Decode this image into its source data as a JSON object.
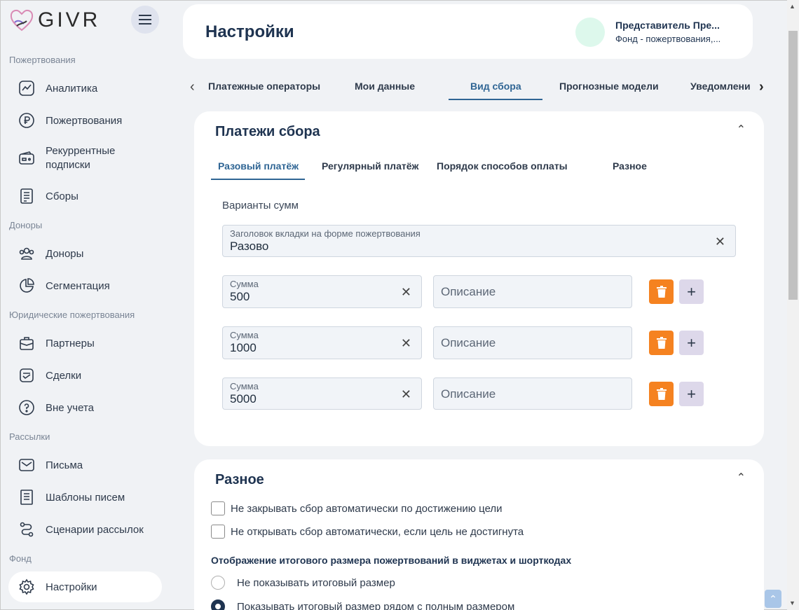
{
  "app": {
    "logo_text": "GIVR"
  },
  "sidebar": {
    "sections": [
      {
        "title": "Пожертвования",
        "items": [
          {
            "label": "Аналитика",
            "icon": "analytics-icon"
          },
          {
            "label": "Пожертвования",
            "icon": "ruble-icon"
          },
          {
            "label": "Рекуррентные подписки",
            "icon": "wallet-icon"
          },
          {
            "label": "Сборы",
            "icon": "receipt-icon"
          }
        ]
      },
      {
        "title": "Доноры",
        "items": [
          {
            "label": "Доноры",
            "icon": "users-icon"
          },
          {
            "label": "Сегментация",
            "icon": "pie-chart-icon"
          }
        ]
      },
      {
        "title": "Юридические пожертвования",
        "items": [
          {
            "label": "Партнеры",
            "icon": "briefcase-icon"
          },
          {
            "label": "Сделки",
            "icon": "deal-icon"
          },
          {
            "label": "Вне учета",
            "icon": "question-icon"
          }
        ]
      },
      {
        "title": "Рассылки",
        "items": [
          {
            "label": "Письма",
            "icon": "mail-icon"
          },
          {
            "label": "Шаблоны писем",
            "icon": "template-icon"
          },
          {
            "label": "Сценарии рассылок",
            "icon": "route-icon"
          }
        ]
      },
      {
        "title": "Фонд",
        "items": [
          {
            "label": "Настройки",
            "icon": "gear-icon",
            "active": true
          }
        ]
      }
    ]
  },
  "header": {
    "title": "Настройки",
    "user_name": "Представитель Пре...",
    "user_org": "Фонд - пожертвования,..."
  },
  "tabs": [
    {
      "label": "Платежные операторы"
    },
    {
      "label": "Мои данные"
    },
    {
      "label": "Вид сбора",
      "active": true
    },
    {
      "label": "Прогнозные модели"
    },
    {
      "label": "Уведомлени"
    }
  ],
  "payments_card": {
    "title": "Платежи сбора",
    "subtabs": [
      {
        "label": "Разовый платёж",
        "active": true
      },
      {
        "label": "Регулярный платёж"
      },
      {
        "label": "Порядок способов оплаты"
      },
      {
        "label": "Разное"
      }
    ],
    "amounts_label": "Варианты сумм",
    "tab_header_field": {
      "label": "Заголовок вкладки на форме пожертвования",
      "value": "Разово"
    },
    "rows": [
      {
        "sum_label": "Сумма",
        "sum_value": "500",
        "desc_placeholder": "Описание"
      },
      {
        "sum_label": "Сумма",
        "sum_value": "1000",
        "desc_placeholder": "Описание"
      },
      {
        "sum_label": "Сумма",
        "sum_value": "5000",
        "desc_placeholder": "Описание"
      }
    ]
  },
  "misc_card": {
    "title": "Разное",
    "checkboxes": [
      "Не закрывать сбор автоматически по достижению цели",
      "Не открывать сбор автоматически, если цель не достигнута"
    ],
    "display_label": "Отображение итогового размера пожертвований в виджетах и шорткодах",
    "radios": [
      {
        "label": "Не показывать итоговый размер",
        "checked": false
      },
      {
        "label": "Показывать итоговый размер рядом с полным размером",
        "checked": true
      }
    ]
  }
}
